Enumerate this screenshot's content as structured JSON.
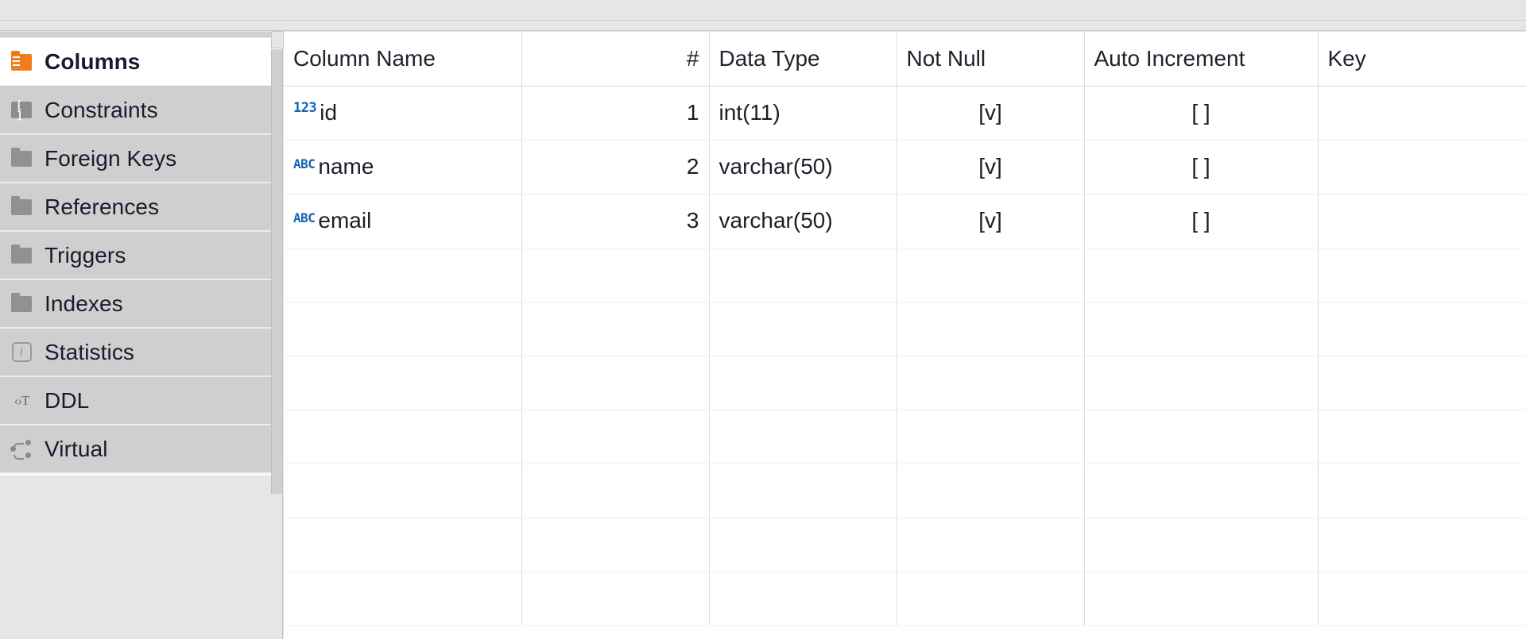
{
  "sidebar": {
    "items": [
      {
        "label": "Columns",
        "icon": "columns-folder-icon",
        "selected": true
      },
      {
        "label": "Constraints",
        "icon": "constraints-icon",
        "selected": false
      },
      {
        "label": "Foreign Keys",
        "icon": "folder-icon",
        "selected": false
      },
      {
        "label": "References",
        "icon": "folder-icon",
        "selected": false
      },
      {
        "label": "Triggers",
        "icon": "folder-icon",
        "selected": false
      },
      {
        "label": "Indexes",
        "icon": "folder-icon",
        "selected": false
      },
      {
        "label": "Statistics",
        "icon": "info-icon",
        "selected": false
      },
      {
        "label": "DDL",
        "icon": "code-text-icon",
        "selected": false
      },
      {
        "label": "Virtual",
        "icon": "virtual-nodes-icon",
        "selected": false
      }
    ]
  },
  "grid": {
    "columns": [
      {
        "key": "name",
        "label": "Column Name",
        "align": "left"
      },
      {
        "key": "num",
        "label": "#",
        "align": "right"
      },
      {
        "key": "type",
        "label": "Data Type",
        "align": "left"
      },
      {
        "key": "null",
        "label": "Not Null",
        "align": "center"
      },
      {
        "key": "auto",
        "label": "Auto Increment",
        "align": "center"
      },
      {
        "key": "key",
        "label": "Key",
        "align": "left"
      }
    ],
    "rows": [
      {
        "name": "id",
        "type_badge": "123",
        "num": "1",
        "type": "int(11)",
        "not_null": "[v]",
        "auto_increment": "[ ]",
        "key": ""
      },
      {
        "name": "name",
        "type_badge": "ABC",
        "num": "2",
        "type": "varchar(50)",
        "not_null": "[v]",
        "auto_increment": "[ ]",
        "key": ""
      },
      {
        "name": "email",
        "type_badge": "ABC",
        "num": "3",
        "type": "varchar(50)",
        "not_null": "[v]",
        "auto_increment": "[ ]",
        "key": ""
      }
    ],
    "empty_row_count": 7
  },
  "colors": {
    "selected_tab_background": "#ffffff",
    "tab_background": "#cfcfcf",
    "columns_folder_accent": "#f07d1a",
    "type_badge": "#1464b4",
    "grid_line": "#dcdcdc",
    "panel_background": "#e6e6e6"
  }
}
